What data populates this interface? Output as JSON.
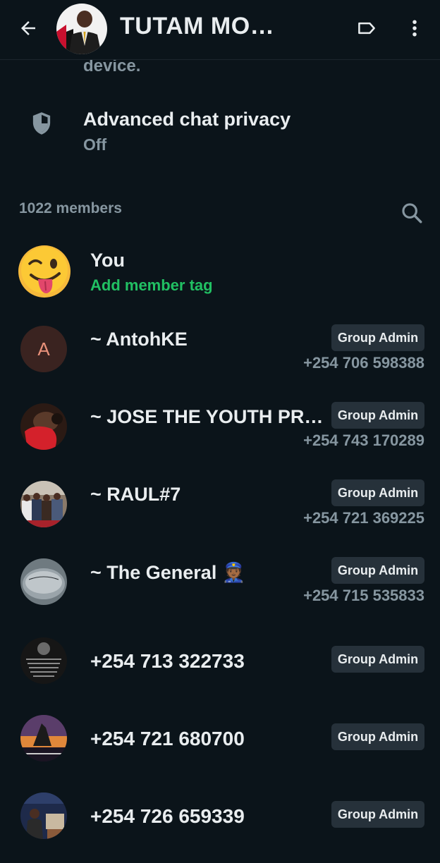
{
  "header": {
    "title": "TUTAM MO…",
    "back_icon": "arrow-left-icon",
    "label_icon": "label-icon",
    "menu_icon": "more-vert-icon"
  },
  "cut_text": "device.",
  "privacy": {
    "title": "Advanced chat privacy",
    "value": "Off",
    "icon": "shield-icon"
  },
  "members": {
    "count_label": "1022 members",
    "search_icon": "search-icon",
    "list": [
      {
        "name": "You",
        "sub": "Add member tag",
        "avatar": "winking-emoji"
      },
      {
        "name": "~ AntohKE",
        "badge": "Group Admin",
        "phone": "+254 706 598388",
        "avatar_letter": "A"
      },
      {
        "name": "~ JOSE THE YOUTH PR…",
        "badge": "Group Admin",
        "phone": "+254 743 170289"
      },
      {
        "name": "~ RAUL#7",
        "badge": "Group Admin",
        "phone": "+254 721 369225"
      },
      {
        "name": "~ The General 👮🏾",
        "badge": "Group Admin",
        "phone": "+254 715 535833"
      },
      {
        "name": "+254 713 322733",
        "badge": "Group Admin"
      },
      {
        "name": "+254 721 680700",
        "badge": "Group Admin"
      },
      {
        "name": "+254 726 659339",
        "badge": "Group Admin"
      }
    ]
  },
  "colors": {
    "background": "#0b141a",
    "accent_green": "#21c063",
    "secondary_text": "#8696a0",
    "badge_bg": "#26313a"
  }
}
